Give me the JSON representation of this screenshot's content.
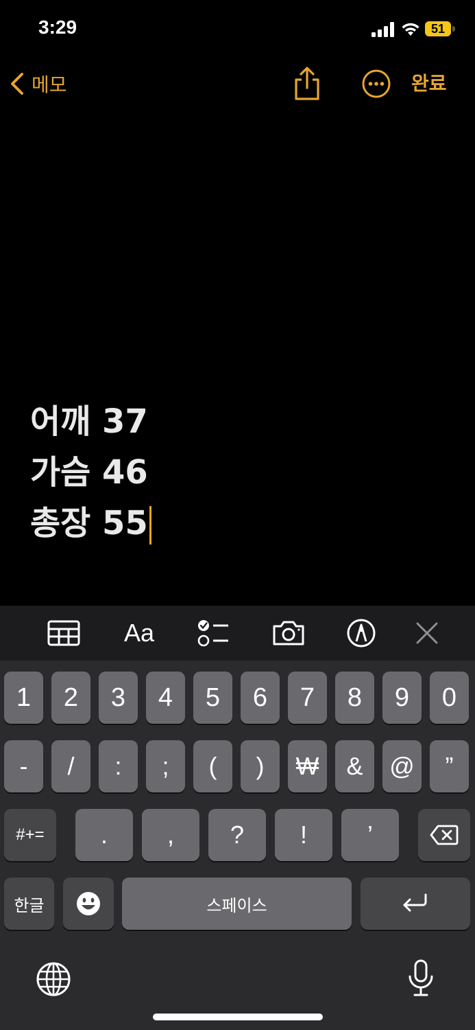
{
  "status_bar": {
    "time": "3:29",
    "battery": "51"
  },
  "nav": {
    "back_label": "메모",
    "done_label": "완료"
  },
  "note": {
    "lines": [
      "어깨 37",
      "가슴 46",
      "총장 55"
    ]
  },
  "format_bar": {
    "text_style_label": "Aa"
  },
  "keyboard": {
    "row1": [
      "1",
      "2",
      "3",
      "4",
      "5",
      "6",
      "7",
      "8",
      "9",
      "0"
    ],
    "row2": [
      "-",
      "/",
      ":",
      ";",
      "(",
      ")",
      "₩",
      "&",
      "@",
      "”"
    ],
    "row3": {
      "shift_label": "#+=",
      "keys": [
        ".",
        ",",
        "?",
        "!",
        "’"
      ]
    },
    "row4": {
      "lang_label": "한글",
      "space_label": "스페이스"
    }
  },
  "colors": {
    "accent": "#e6a531",
    "battery": "#f5c518",
    "background": "#000000",
    "key": "#6a6a6e",
    "key_dark": "#464648"
  }
}
